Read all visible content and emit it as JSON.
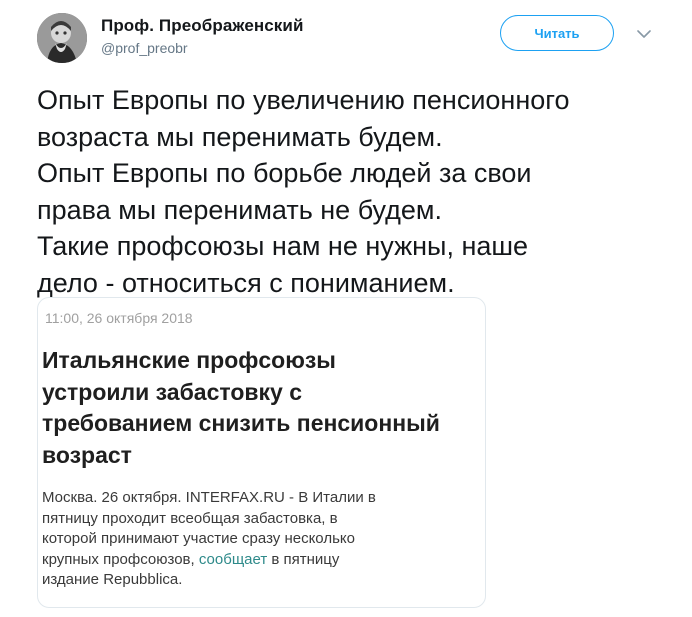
{
  "author": {
    "name": "Проф. Преображенский",
    "handle": "@prof_preobr"
  },
  "actions": {
    "follow_label": "Читать"
  },
  "icons": {
    "more": "chevron-down-icon"
  },
  "tweet": {
    "lines": [
      "Опыт Европы по увеличению пенсионного",
      "возраста мы перенимать будем.",
      "Опыт Европы по борьбе людей за свои",
      "права мы перенимать не будем.",
      "Такие профсоюзы нам не нужны, наше",
      "дело - относиться с пониманием."
    ]
  },
  "media": {
    "date": "11:00, 26 октября 2018",
    "headline_lines": [
      "Итальянские профсоюзы",
      "устроили забастовку с",
      "требованием снизить пенсионный",
      "возраст"
    ],
    "body_lines": [
      "Москва. 26 октября. INTERFAX.RU - В Италии в",
      "пятницу проходит всеобщая забастовка, в",
      "которой принимают участие сразу несколько"
    ],
    "body_line4_prefix": "крупных профсоюзов,",
    "body_line4_link": "сообщает",
    "body_line4_suffix": "в пятницу",
    "body_line5": "издание Repubblica."
  },
  "colors": {
    "accent": "#1da1f2",
    "link": "#2e8a8a",
    "handle": "#657786"
  }
}
